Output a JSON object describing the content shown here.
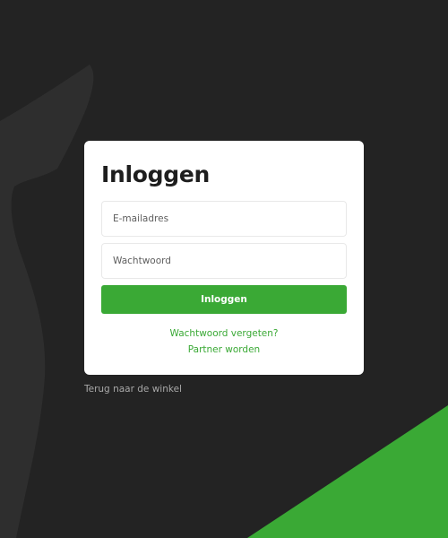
{
  "colors": {
    "background": "#232323",
    "background_shape": "#2f2f2f",
    "accent_green": "#3aa935",
    "card": "#ffffff",
    "back_link": "#a8a8a8"
  },
  "login": {
    "title": "Inloggen",
    "email_placeholder": "E-mailadres",
    "password_placeholder": "Wachtwoord",
    "submit_label": "Inloggen",
    "forgot_password_label": "Wachtwoord vergeten?",
    "become_partner_label": "Partner worden"
  },
  "footer": {
    "back_to_shop_label": "Terug naar de winkel"
  }
}
